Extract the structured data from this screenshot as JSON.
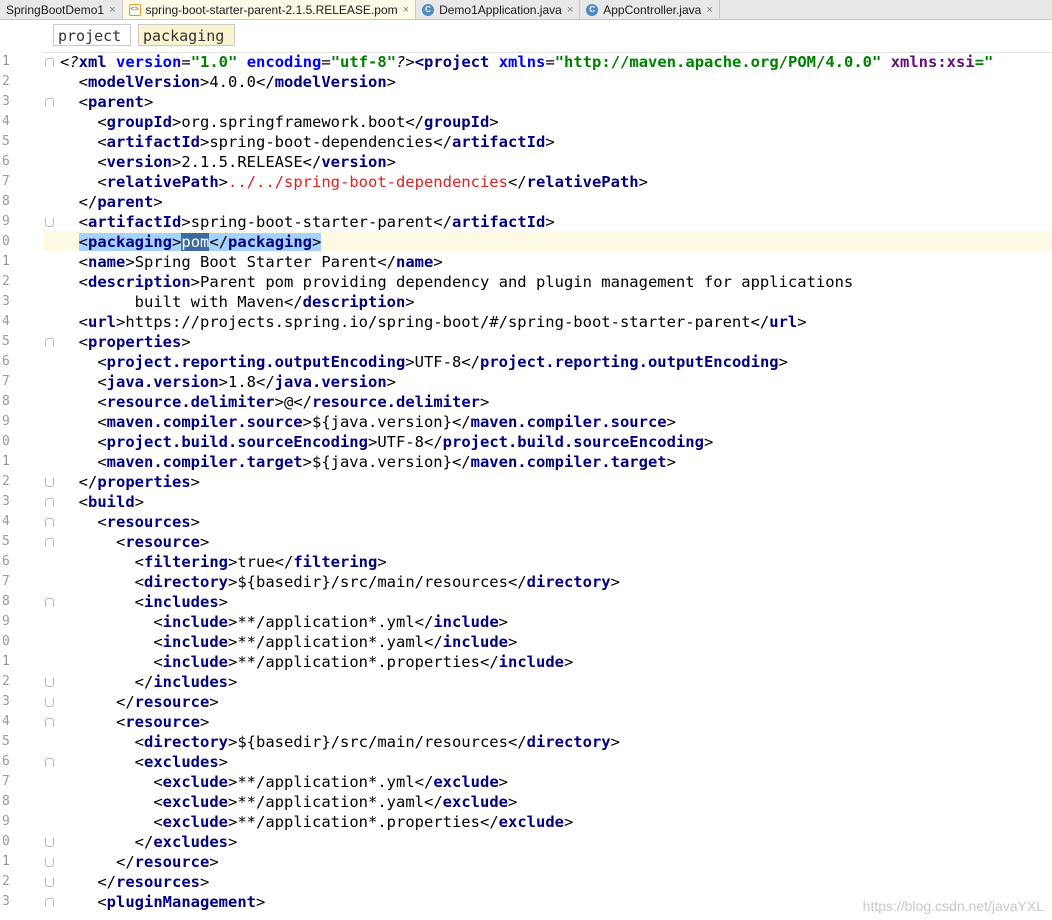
{
  "tabs": [
    {
      "label": "SpringBootDemo1",
      "icon": "none",
      "active": false
    },
    {
      "label": "spring-boot-starter-parent-2.1.5.RELEASE.pom",
      "icon": "xml-file-icon",
      "active": true
    },
    {
      "label": "Demo1Application.java",
      "icon": "java-class-icon",
      "active": false
    },
    {
      "label": "AppController.java",
      "icon": "java-class-icon",
      "active": false
    }
  ],
  "tab_close_glyph": "×",
  "breadcrumb": [
    "project",
    "packaging"
  ],
  "line_numbers": [
    "1",
    "2",
    "3",
    "4",
    "5",
    "6",
    "7",
    "8",
    "9",
    "0",
    "1",
    "2",
    "3",
    "4",
    "5",
    "6",
    "7",
    "8",
    "9",
    "0",
    "1",
    "2",
    "3",
    "4",
    "5",
    "6",
    "7",
    "8",
    "9",
    "0",
    "1",
    "2",
    "3",
    "4",
    "5",
    "6",
    "7",
    "8",
    "9",
    "0",
    "1",
    "2",
    "3"
  ],
  "code": {
    "l1_pi_open": "<?",
    "l1_xml": "xml",
    "l1_version_attr": "version",
    "l1_version_val": "\"1.0\"",
    "l1_encoding_attr": "encoding",
    "l1_encoding_val": "\"utf-8\"",
    "l1_pi_close": "?>",
    "l1_project": "<project",
    "l1_xmlns_attr": "xmlns",
    "l1_xmlns_val": "\"http://maven.apache.org/POM/4.0.0\"",
    "l1_xsi_attr": "xmlns:xsi",
    "l1_xsi_tail": "=\"",
    "lines": [
      {
        "indent": "  ",
        "open": "modelVersion",
        "text": "4.0.0",
        "close": "modelVersion"
      },
      {
        "indent": "  ",
        "open": "parent"
      },
      {
        "indent": "    ",
        "open": "groupId",
        "text": "org.springframework.boot",
        "close": "groupId"
      },
      {
        "indent": "    ",
        "open": "artifactId",
        "text": "spring-boot-dependencies",
        "close": "artifactId"
      },
      {
        "indent": "    ",
        "open": "version",
        "text": "2.1.5.RELEASE",
        "close": "version"
      },
      {
        "indent": "    ",
        "open": "relativePath",
        "text": "../../spring-boot-dependencies",
        "close": "relativePath",
        "red": true
      },
      {
        "indent": "  ",
        "close_only": "parent"
      },
      {
        "indent": "  ",
        "open": "artifactId",
        "text": "spring-boot-starter-parent",
        "close": "artifactId"
      },
      {
        "indent": "  ",
        "open": "packaging",
        "text": "pom",
        "close": "packaging",
        "highlight": true
      },
      {
        "indent": "  ",
        "open": "name",
        "text": "Spring Boot Starter Parent",
        "close": "name"
      },
      {
        "indent": "  ",
        "open": "description",
        "text": "Parent pom providing dependency and plugin management for applications"
      },
      {
        "indent": "        ",
        "text_only": "built with Maven",
        "close": "description"
      },
      {
        "indent": "  ",
        "open": "url",
        "text": "https://projects.spring.io/spring-boot/#/spring-boot-starter-parent",
        "close": "url"
      },
      {
        "indent": "  ",
        "open": "properties"
      },
      {
        "indent": "    ",
        "open": "project.reporting.outputEncoding",
        "text": "UTF-8",
        "close": "project.reporting.outputEncoding"
      },
      {
        "indent": "    ",
        "open": "java.version",
        "text": "1.8",
        "close": "java.version"
      },
      {
        "indent": "    ",
        "open": "resource.delimiter",
        "text": "@",
        "close": "resource.delimiter"
      },
      {
        "indent": "    ",
        "open": "maven.compiler.source",
        "text": "${java.version}",
        "close": "maven.compiler.source"
      },
      {
        "indent": "    ",
        "open": "project.build.sourceEncoding",
        "text": "UTF-8",
        "close": "project.build.sourceEncoding"
      },
      {
        "indent": "    ",
        "open": "maven.compiler.target",
        "text": "${java.version}",
        "close": "maven.compiler.target"
      },
      {
        "indent": "  ",
        "close_only": "properties"
      },
      {
        "indent": "  ",
        "open": "build"
      },
      {
        "indent": "    ",
        "open": "resources"
      },
      {
        "indent": "      ",
        "open": "resource"
      },
      {
        "indent": "        ",
        "open": "filtering",
        "text": "true",
        "close": "filtering"
      },
      {
        "indent": "        ",
        "open": "directory",
        "text": "${basedir}/src/main/resources",
        "close": "directory"
      },
      {
        "indent": "        ",
        "open": "includes"
      },
      {
        "indent": "          ",
        "open": "include",
        "text": "**/application*.yml",
        "close": "include"
      },
      {
        "indent": "          ",
        "open": "include",
        "text": "**/application*.yaml",
        "close": "include"
      },
      {
        "indent": "          ",
        "open": "include",
        "text": "**/application*.properties",
        "close": "include"
      },
      {
        "indent": "        ",
        "close_only": "includes"
      },
      {
        "indent": "      ",
        "close_only": "resource"
      },
      {
        "indent": "      ",
        "open": "resource"
      },
      {
        "indent": "        ",
        "open": "directory",
        "text": "${basedir}/src/main/resources",
        "close": "directory"
      },
      {
        "indent": "        ",
        "open": "excludes"
      },
      {
        "indent": "          ",
        "open": "exclude",
        "text": "**/application*.yml",
        "close": "exclude"
      },
      {
        "indent": "          ",
        "open": "exclude",
        "text": "**/application*.yaml",
        "close": "exclude"
      },
      {
        "indent": "          ",
        "open": "exclude",
        "text": "**/application*.properties",
        "close": "exclude"
      },
      {
        "indent": "        ",
        "close_only": "excludes"
      },
      {
        "indent": "      ",
        "close_only": "resource"
      },
      {
        "indent": "    ",
        "close_only": "resources"
      },
      {
        "indent": "    ",
        "open": "pluginManagement"
      }
    ]
  },
  "watermark": "https://blog.csdn.net/javaYXL",
  "colors": {
    "tag": "#000080",
    "attribute": "#0000ff",
    "string": "#008000",
    "current_line": "#fffae3",
    "selection": "#a6d2ff"
  }
}
